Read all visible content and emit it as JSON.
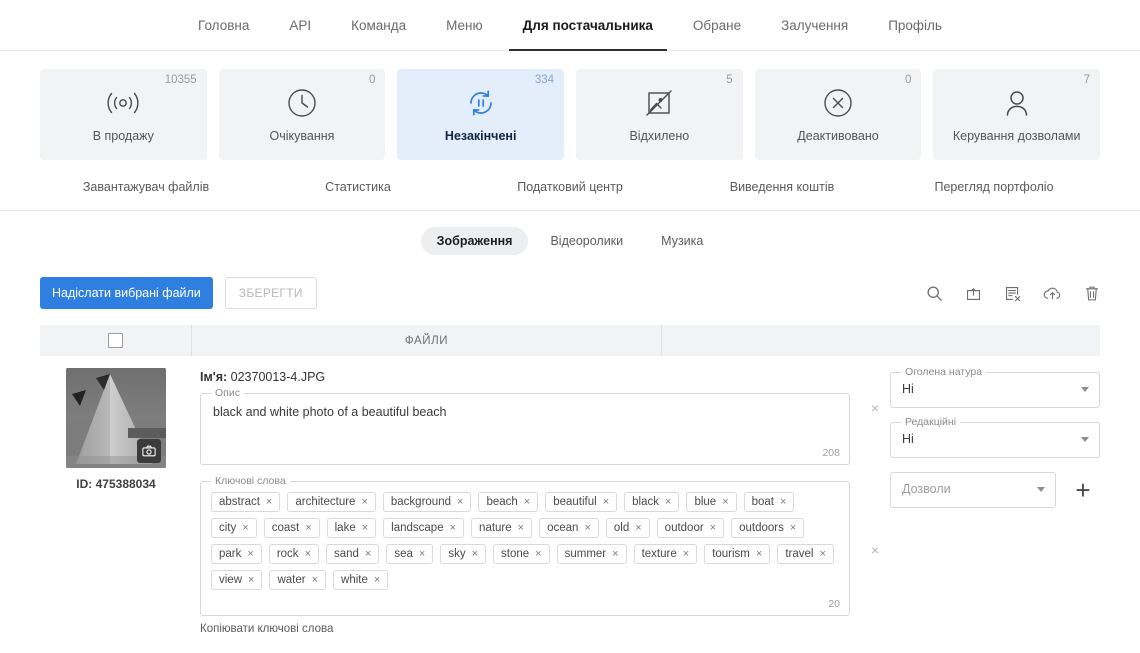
{
  "topnav": {
    "items": [
      {
        "label": "Головна",
        "active": false
      },
      {
        "label": "API",
        "active": false
      },
      {
        "label": "Команда",
        "active": false
      },
      {
        "label": "Меню",
        "active": false
      },
      {
        "label": "Для постачальника",
        "active": true
      },
      {
        "label": "Обране",
        "active": false
      },
      {
        "label": "Залучення",
        "active": false
      },
      {
        "label": "Профіль",
        "active": false
      }
    ]
  },
  "cards": [
    {
      "label": "В продажу",
      "count": "10355",
      "icon": "broadcast-icon",
      "active": false
    },
    {
      "label": "Очікування",
      "count": "0",
      "icon": "clock-icon",
      "active": false
    },
    {
      "label": "Незакінчені",
      "count": "334",
      "icon": "refresh-pause-icon",
      "active": true
    },
    {
      "label": "Відхилено",
      "count": "5",
      "icon": "image-rejected-icon",
      "active": false
    },
    {
      "label": "Деактивовано",
      "count": "0",
      "icon": "circle-x-icon",
      "active": false
    },
    {
      "label": "Керування дозволами",
      "count": "7",
      "icon": "person-icon",
      "active": false
    }
  ],
  "sublinks": [
    {
      "label": "Завантажувач файлів"
    },
    {
      "label": "Статистика"
    },
    {
      "label": "Податковий центр"
    },
    {
      "label": "Виведення коштів"
    },
    {
      "label": "Перегляд портфоліо"
    }
  ],
  "mediatabs": [
    {
      "label": "Зображення",
      "active": true
    },
    {
      "label": "Відеоролики",
      "active": false
    },
    {
      "label": "Музика",
      "active": false
    }
  ],
  "actionbar": {
    "submit_label": "Надіслати вибрані файли",
    "save_label": "ЗБЕРЕГТИ",
    "tools": [
      {
        "name": "search-icon"
      },
      {
        "name": "reassign-icon"
      },
      {
        "name": "clear-metadata-icon"
      },
      {
        "name": "cloud-upload-icon"
      },
      {
        "name": "delete-icon"
      }
    ]
  },
  "table": {
    "header": {
      "files_label": "ФАЙЛИ"
    }
  },
  "file": {
    "id_label": "ID: 475388034",
    "name_label": "Ім'я:",
    "name_value": "02370013-4.JPG",
    "description": {
      "legend": "Опис",
      "value": "black and white photo of a beautiful beach",
      "counter": "208"
    },
    "keywords": {
      "legend": "Ключові слова",
      "counter": "20",
      "chips": [
        "abstract",
        "architecture",
        "background",
        "beach",
        "beautiful",
        "black",
        "blue",
        "boat",
        "city",
        "coast",
        "lake",
        "landscape",
        "nature",
        "ocean",
        "old",
        "outdoor",
        "outdoors",
        "park",
        "rock",
        "sand",
        "sea",
        "sky",
        "stone",
        "summer",
        "texture",
        "tourism",
        "travel",
        "view",
        "water",
        "white"
      ],
      "remove_glyph": "×"
    },
    "copy_keywords_label": "Копіювати ключові слова",
    "remove_glyph": "×"
  },
  "sidefields": {
    "nudity": {
      "legend": "Оголена натура",
      "value": "Ні"
    },
    "editorial": {
      "legend": "Редакційні",
      "value": "Ні"
    },
    "permissions": {
      "legend": "",
      "placeholder": "Дозволи",
      "add_label": "+"
    }
  },
  "colors": {
    "primary": "#2f7fe0",
    "active_card_bg": "#e4eefb",
    "card_bg": "#f1f3f4"
  }
}
